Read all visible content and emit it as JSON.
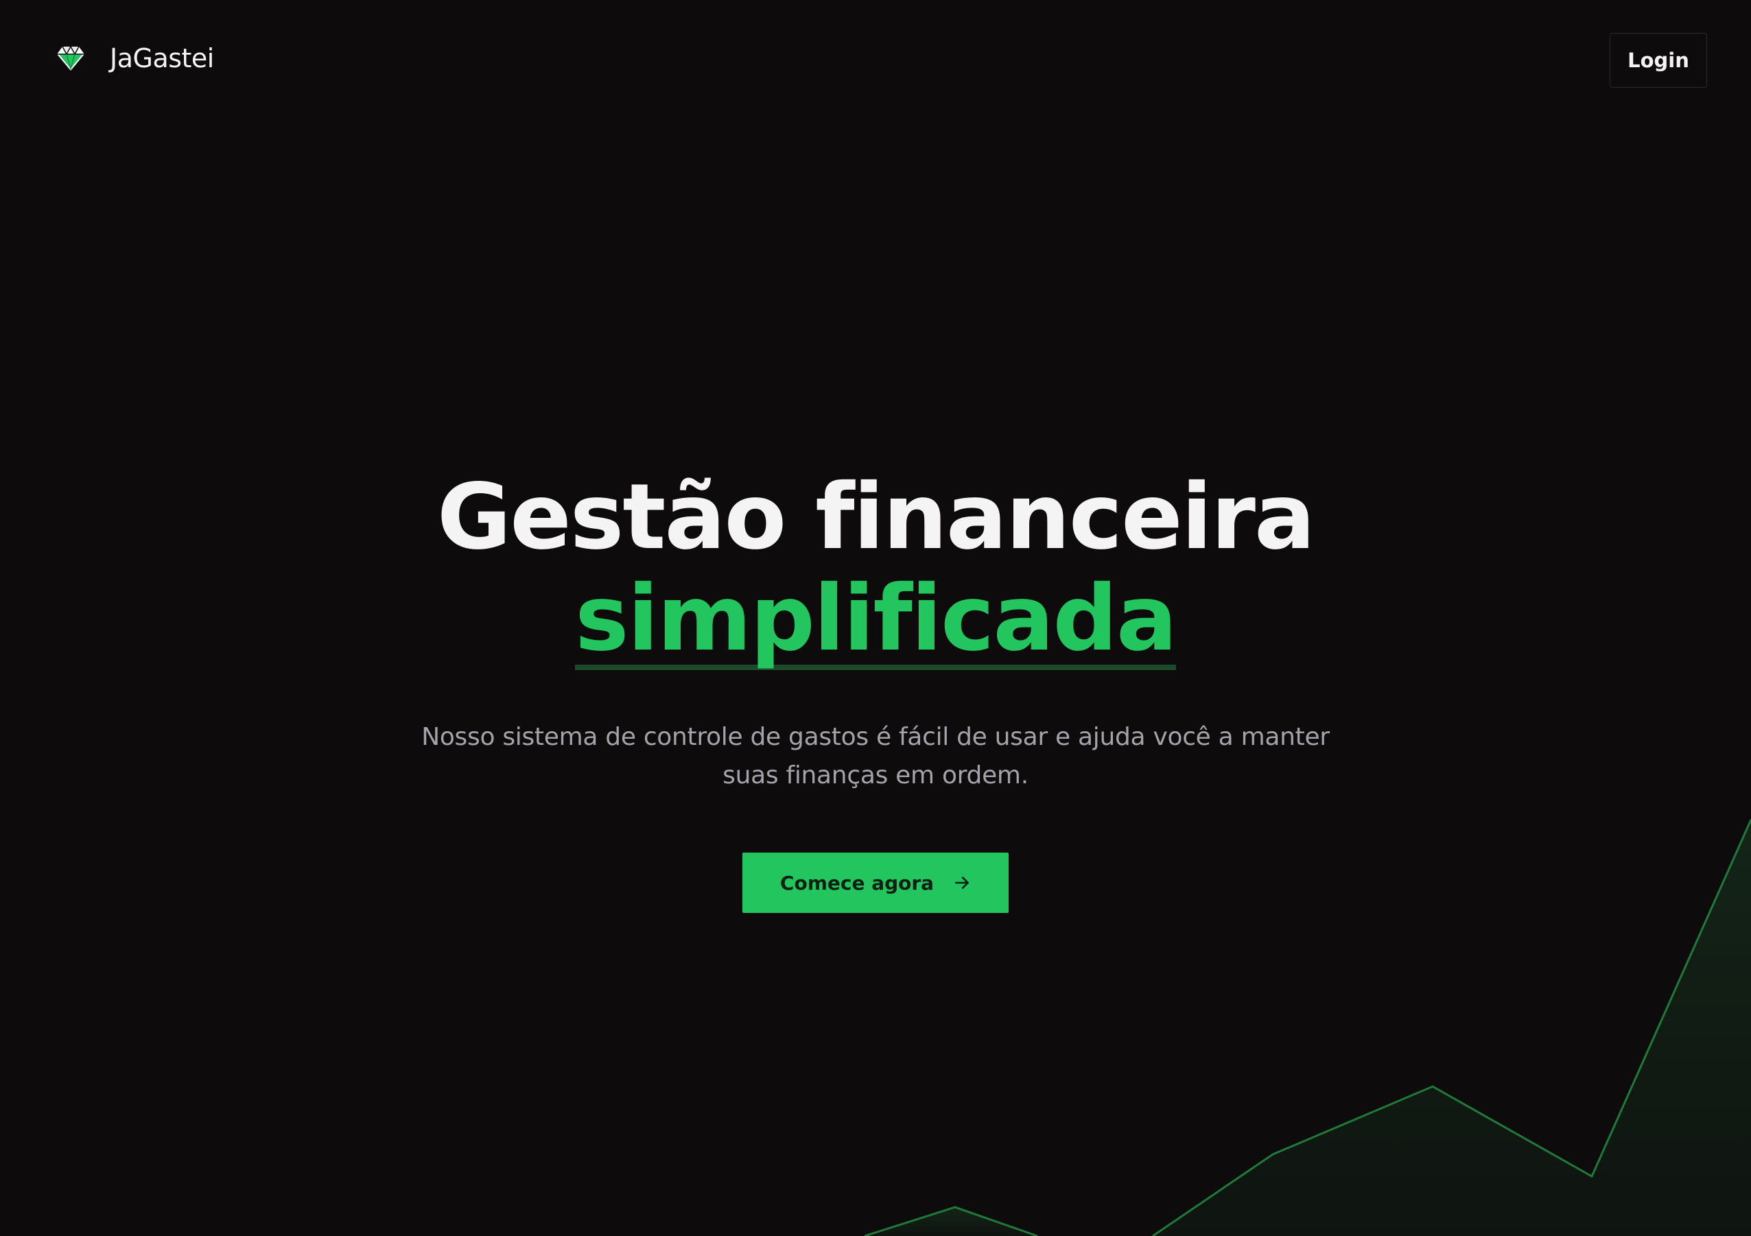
{
  "app": {
    "name": "JaGastei",
    "logo_icon": "diamond-icon",
    "accent_color": "#22c55e",
    "background_color": "#0d0b0b"
  },
  "nav": {
    "login_label": "Login"
  },
  "hero": {
    "title_line1": "Gestão financeira",
    "title_line2": "simplificada",
    "subtitle": "Nosso sistema de controle de gastos é fácil de usar e ajuda você a manter suas finanças em ordem.",
    "cta_label": "Comece agora",
    "cta_icon": "arrow-right-icon"
  }
}
